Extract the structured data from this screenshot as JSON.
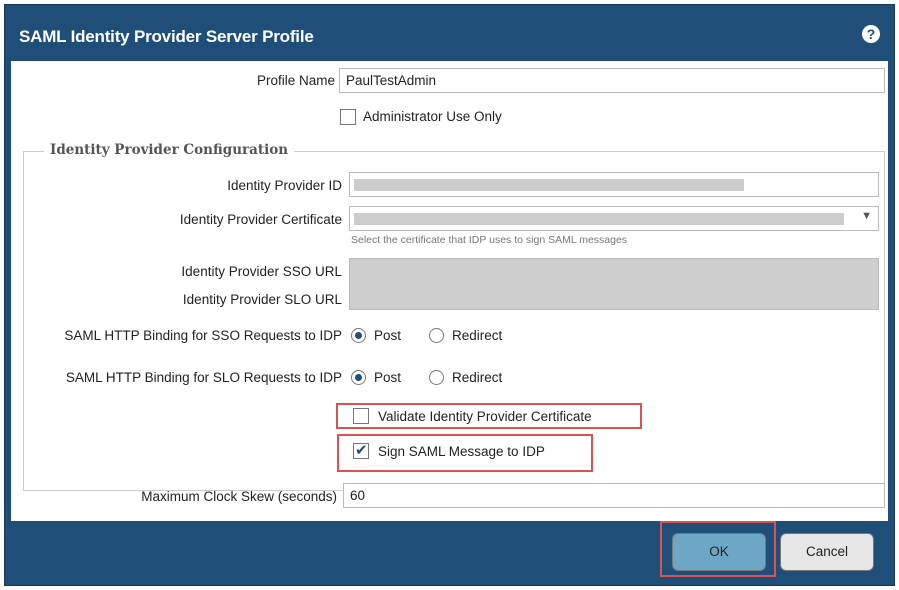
{
  "dialog": {
    "title": "SAML Identity Provider Server Profile",
    "help_icon": "question-circle-icon"
  },
  "profile_name": {
    "label": "Profile Name",
    "value": "PaulTestAdmin"
  },
  "admin_use_only": {
    "label": "Administrator Use Only",
    "checked": false
  },
  "idp_config": {
    "legend": "Identity Provider Configuration",
    "idp_id": {
      "label": "Identity Provider ID",
      "value": ""
    },
    "idp_cert": {
      "label": "Identity Provider Certificate",
      "hint": "Select the certificate that IDP uses to sign SAML messages"
    },
    "sso_url": {
      "label": "Identity Provider SSO URL"
    },
    "slo_url": {
      "label": "Identity Provider SLO URL"
    },
    "sso_binding": {
      "label": "SAML HTTP Binding for SSO Requests to IDP",
      "post": "Post",
      "redirect": "Redirect",
      "selected": "Post"
    },
    "slo_binding": {
      "label": "SAML HTTP Binding for SLO Requests to IDP",
      "post": "Post",
      "redirect": "Redirect",
      "selected": "Post"
    }
  },
  "validate_cert": {
    "label": "Validate Identity Provider Certificate",
    "checked": false
  },
  "sign_saml": {
    "label": "Sign SAML Message to IDP",
    "checked": true
  },
  "clock_skew": {
    "label": "Maximum Clock Skew (seconds)",
    "value": "60"
  },
  "buttons": {
    "ok": "OK",
    "cancel": "Cancel"
  },
  "colors": {
    "title_bar": "#1f4e79",
    "highlight": "#d9534f",
    "ok_button": "#6ea6c6"
  }
}
